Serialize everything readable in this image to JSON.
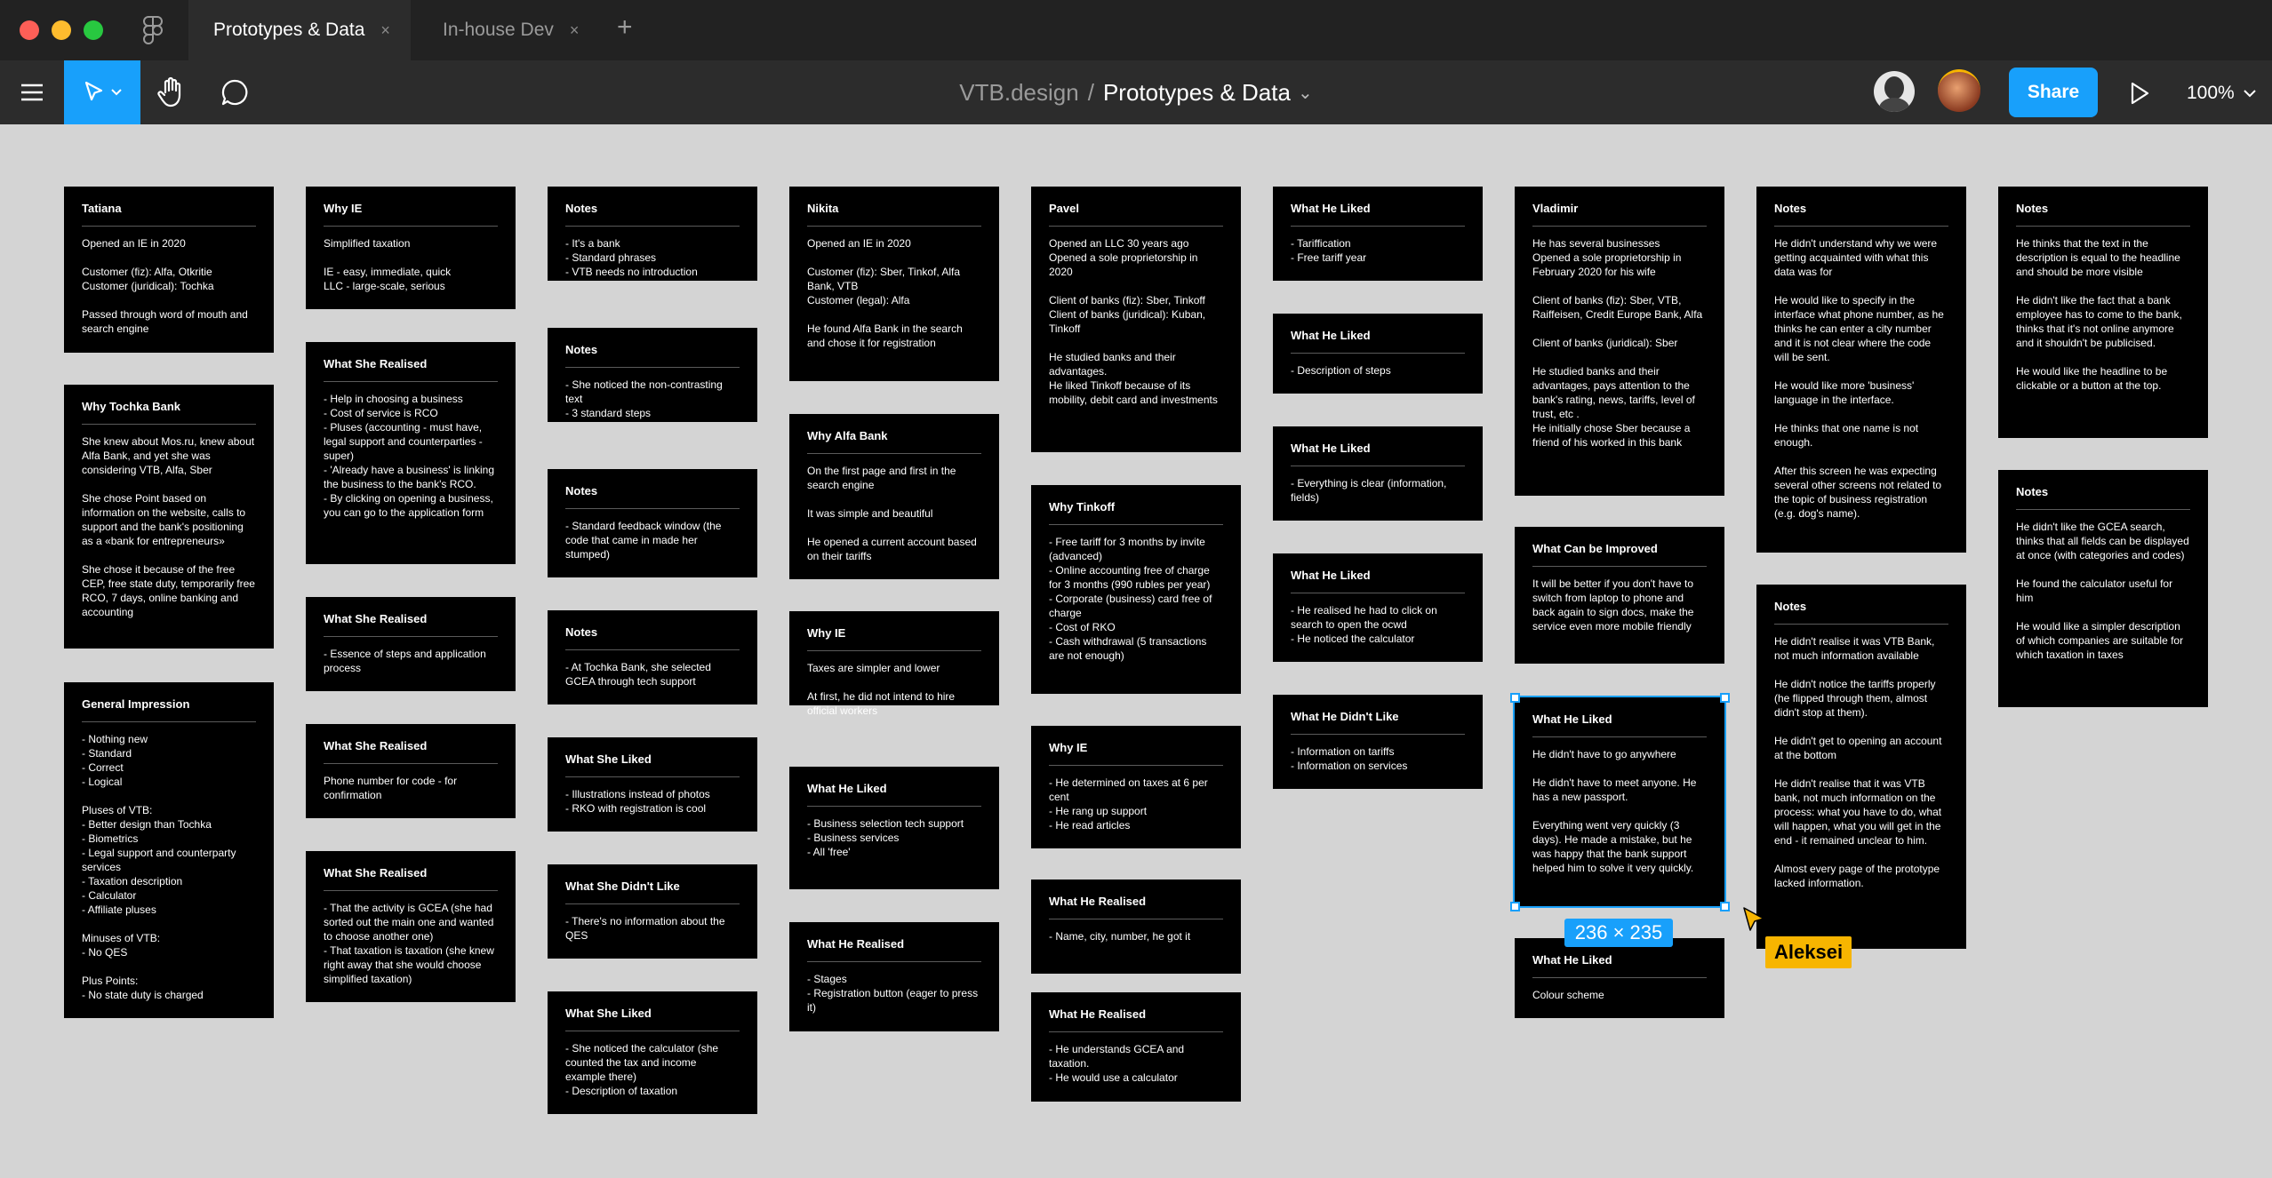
{
  "tabs": [
    {
      "label": "Prototypes & Data",
      "close": "×"
    },
    {
      "label": "In-house Dev",
      "close": "×"
    }
  ],
  "new_tab": "+",
  "breadcrumb": {
    "team": "VTB.design",
    "separator": "/",
    "file": "Prototypes & Data",
    "caret": "⌄"
  },
  "share_label": "Share",
  "zoom_label": "100%",
  "selection_size": "236 × 235",
  "cursor_user": "Aleksei",
  "colors": {
    "accent": "#18a0fb",
    "cursor": "#f7b500",
    "canvas": "#d4d4d4"
  },
  "icons": [
    "figma-logo-icon",
    "menu-icon",
    "move-tool-icon",
    "hand-tool-icon",
    "comment-icon",
    "play-icon",
    "chevron-down-icon"
  ],
  "columns": [
    [
      {
        "title": "Tatiana",
        "body": "Opened an IE in 2020\n\nCustomer (fiz): Alfa, Otkritie\nCustomer (juridical): Tochka\n\nPassed through word of mouth and search engine"
      },
      {
        "title": "Why Tochka Bank",
        "body": "She knew about Mos.ru, knew about Alfa Bank, and yet she was considering VTB, Alfa, Sber\n\nShe chose Point based on information on the website, calls to support and the bank's positioning as a «bank for entrepreneurs»\n\nShe chose it because of the free CEP, free state duty, temporarily free RCO, 7 days, online banking and accounting"
      },
      {
        "title": "General Impression",
        "body": "- Nothing new\n- Standard\n- Correct\n- Logical\n\nPluses of VTB:\n- Better design than Tochka\n- Biometrics\n- Legal support and counterparty services\n- Taxation description\n- Calculator\n- Affiliate pluses\n\nMinuses of VTB:\n- No QES\n\nPlus Points:\n- No state duty is charged"
      }
    ],
    [
      {
        "title": "Why IE",
        "body": "Simplified taxation\n\nIE - easy, immediate, quick\nLLC - large-scale, serious"
      },
      {
        "title": "What She Realised",
        "body": "- Help in choosing a business\n- Cost of service is RCO\n- Pluses (accounting - must have, legal support and counterparties - super)\n- 'Already have a business' is linking the business to the bank's RCO.\n- By clicking on opening a business, you can go to the application form"
      },
      {
        "title": "What She Realised",
        "body": "- Essence of steps and application process"
      },
      {
        "title": "What She Realised",
        "body": "Phone number for code - for confirmation"
      },
      {
        "title": "What She Realised",
        "body": "- That the activity is GCEA (she had sorted out the main one and wanted to choose another one)\n- That taxation is taxation (she knew right away that she would choose simplified taxation)"
      }
    ],
    [
      {
        "title": "Notes",
        "body": "- It's a bank\n- Standard phrases\n- VTB needs no introduction"
      },
      {
        "title": "Notes",
        "body": "- She noticed the non-contrasting text\n- 3 standard steps"
      },
      {
        "title": "Notes",
        "body": "- Standard feedback window (the code that came in made her stumped)"
      },
      {
        "title": "Notes",
        "body": "- At Tochka Bank, she selected GCEA through tech support"
      },
      {
        "title": "What She Liked",
        "body": "- Illustrations instead of photos\n- RKO with registration is cool"
      },
      {
        "title": "What She Didn't Like",
        "body": "- There's no information about the QES"
      },
      {
        "title": "What She Liked",
        "body": "- She noticed the calculator (she counted the tax and income example there)\n- Description of taxation"
      }
    ],
    [
      {
        "title": "Nikita",
        "body": "Opened an IE in 2020\n\nCustomer (fiz): Sber, Tinkof, Alfa Bank, VTB\nCustomer (legal): Alfa\n\nHe found Alfa Bank in the search and chose it for registration"
      },
      {
        "title": "Why Alfa Bank",
        "body": "On the first page and first in the search engine\n\nIt was simple and beautiful\n\nHe opened a current account based on their tariffs"
      },
      {
        "title": "Why IE",
        "body": "Taxes are simpler and lower\n\nAt first, he did not intend to hire official workers"
      },
      {
        "title": "What He Liked",
        "body": "- Business selection tech support\n- Business services\n- All 'free'"
      },
      {
        "title": "What He Realised",
        "body": "- Stages\n- Registration button (eager to press it)"
      }
    ],
    [
      {
        "title": "Pavel",
        "body": "Opened an LLC 30 years ago\nOpened a sole proprietorship in 2020\n\nClient of banks (fiz): Sber, Tinkoff\nClient of banks (juridical): Kuban, Tinkoff\n\nHe studied banks and their advantages.\nHe liked Tinkoff because of its mobility, debit card and investments"
      },
      {
        "title": "Why Tinkoff",
        "body": "- Free tariff for 3 months by invite (advanced)\n- Online accounting free of charge for 3 months (990 rubles per year)\n- Corporate (business) card free of charge\n- Cost of RKO\n- Cash withdrawal (5 transactions are not enough)"
      },
      {
        "title": "Why IE",
        "body": "- He determined on taxes at 6 per cent\n- He rang up support\n- He read articles"
      },
      {
        "title": "What He Realised",
        "body": "- Name, city, number, he got it"
      },
      {
        "title": "What He Realised",
        "body": "- He understands GCEA and taxation.\n- He would use a calculator"
      }
    ],
    [
      {
        "title": "What He Liked",
        "body": "- Tariffication\n- Free tariff year"
      },
      {
        "title": "What He Liked",
        "body": "- Description of steps"
      },
      {
        "title": "What He Liked",
        "body": "- Everything is clear (information, fields)"
      },
      {
        "title": "What He Liked",
        "body": "- He realised he had to click on search to open the ocwd\n- He noticed the calculator"
      },
      {
        "title": "What He Didn't Like",
        "body": "- Information on tariffs\n- Information on services"
      }
    ],
    [
      {
        "title": "Vladimir",
        "body": "He has several businesses\nOpened a sole proprietorship in February 2020 for his wife\n\nClient of banks (fiz): Sber, VTB, Raiffeisen, Credit Europe Bank, Alfa\n\nClient of banks (juridical): Sber\n\nHe studied banks and their advantages, pays attention to the bank's rating, news, tariffs, level of trust, etc .\nHe initially chose Sber because a friend of his worked in this bank"
      },
      {
        "title": "What Can be Improved",
        "body": "It will be better if you don't have to switch from laptop to phone and back again to sign docs, make the service even more mobile friendly"
      },
      {
        "title": "What He Liked",
        "body": "He didn't have to go anywhere\n\nHe didn't have to meet anyone. He has a new passport.\n\nEverything went very quickly (3 days). He made a mistake, but he was happy that the bank support helped him to solve it very quickly."
      },
      {
        "title": "What He Liked",
        "body": "Colour scheme"
      }
    ],
    [
      {
        "title": "Notes",
        "body": "He didn't understand why we were getting acquainted with what this data was for\n\nHe would like to specify in the interface what phone number, as he thinks he can enter a city number and it is not clear where the code will be sent.\n\nHe would like more 'business' language in the interface.\n\nHe thinks that one name is not enough.\n\nAfter this screen he was expecting several other screens not related to the topic of business registration (e.g. dog's name)."
      },
      {
        "title": "Notes",
        "body": "He didn't realise it was VTB Bank, not much information available\n\nHe didn't notice the tariffs properly (he flipped through them, almost didn't stop at them).\n\nHe didn't get to opening an account at the bottom\n\nHe didn't realise that it was VTB bank, not much information on the process: what you have to do, what will happen, what you will get in the end - it remained unclear to him.\n\nAlmost every page of the prototype lacked information."
      }
    ],
    [
      {
        "title": "Notes",
        "body": "He thinks that the text in the description is equal to the headline and should be more visible\n\nHe didn't like the fact that a bank employee has to come to the bank, thinks that it's not online anymore and it shouldn't be publicised.\n\nHe would like the headline to be clickable or a button at the top."
      },
      {
        "title": "Notes",
        "body": "He didn't like the GCEA search, thinks that all fields can be displayed at once (with categories and codes)\n\nHe found the calculator useful for him\n\nHe would like a simpler description of which companies are suitable for which taxation in taxes"
      }
    ]
  ]
}
